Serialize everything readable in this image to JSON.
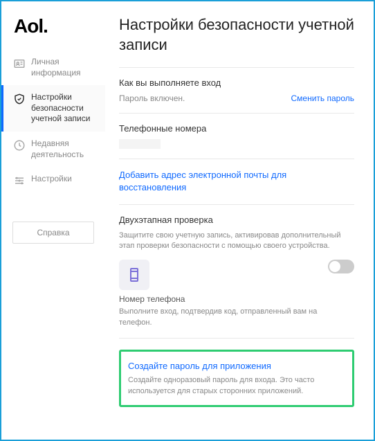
{
  "logo": "Aol.",
  "sidebar": {
    "items": [
      {
        "label": "Личная информация"
      },
      {
        "label": "Настройки безопасности учетной записи"
      },
      {
        "label": "Недавняя деятельность"
      },
      {
        "label": "Настройки"
      }
    ],
    "help": "Справка"
  },
  "main": {
    "title": "Настройки безопасности учетной записи",
    "signin": {
      "heading": "Как вы выполняете вход",
      "status": "Пароль включен.",
      "change": "Сменить пароль"
    },
    "phones": {
      "heading": "Телефонные номера"
    },
    "recovery": {
      "link": "Добавить адрес электронной почты для восстановления"
    },
    "twostep": {
      "heading": "Двухэтапная проверка",
      "desc": "Защитите свою учетную запись, активировав дополнительный этап проверки безопасности с помощью своего устройства.",
      "phone_label": "Номер телефона",
      "phone_desc": "Выполните вход, подтвердив код, отправленный вам на телефон."
    },
    "app_password": {
      "link": "Создайте пароль для приложения",
      "desc": "Создайте одноразовый пароль для входа. Это часто используется для старых сторонних приложений."
    }
  }
}
